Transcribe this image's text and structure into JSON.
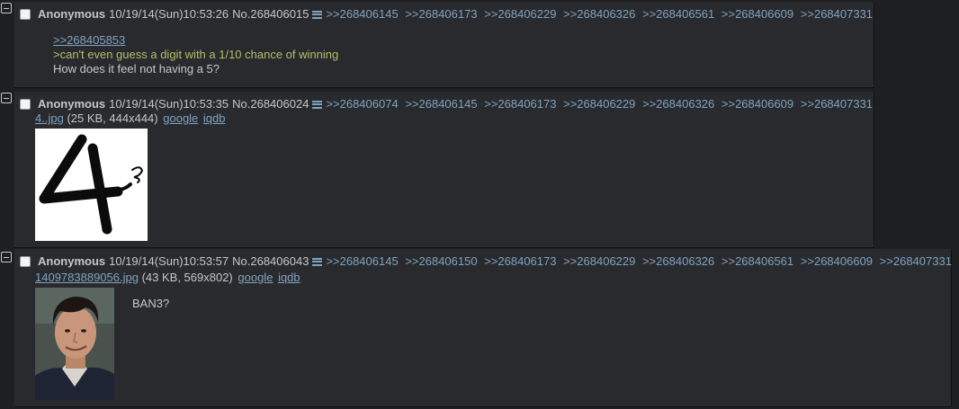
{
  "posts": [
    {
      "name": "Anonymous",
      "datetime": "10/19/14(Sun)10:53:26",
      "number": "No.268406015",
      "backlinks": [
        ">>268406145",
        ">>268406173",
        ">>268406229",
        ">>268406326",
        ">>268406561",
        ">>268406609",
        ">>268407331"
      ],
      "message": {
        "quote_link": ">>268405853",
        "greentext": ">can't even guess a digit with a 1/10 chance of winning",
        "text": "How does it feel not having a 5?"
      }
    },
    {
      "name": "Anonymous",
      "datetime": "10/19/14(Sun)10:53:35",
      "number": "No.268406024",
      "backlinks": [
        ">>268406074",
        ">>268406145",
        ">>268406173",
        ">>268406229",
        ">>268406326",
        ">>268406609",
        ">>268407331"
      ],
      "file": {
        "filename": "4..jpg",
        "meta": "(25 KB, 444x444)",
        "google": "google",
        "iqdb": "iqdb"
      },
      "thumb_icon": "handwritten-four-image"
    },
    {
      "name": "Anonymous",
      "datetime": "10/19/14(Sun)10:53:57",
      "number": "No.268406043",
      "backlinks": [
        ">>268406145",
        ">>268406150",
        ">>268406173",
        ">>268406229",
        ">>268406326",
        ">>268406561",
        ">>268406609",
        ">>268407331"
      ],
      "file": {
        "filename": "1409783889056.jpg",
        "meta": "(43 KB, 569x802)",
        "google": "google",
        "iqdb": "iqdb"
      },
      "thumb_icon": "man-portrait-photo",
      "message": {
        "text": "BAN3?"
      }
    }
  ],
  "colors": {
    "background": "#1d1f21",
    "post_background": "#282a2e",
    "text": "#c5c8c6",
    "link": "#81a2be",
    "greentext": "#b5bd68"
  }
}
